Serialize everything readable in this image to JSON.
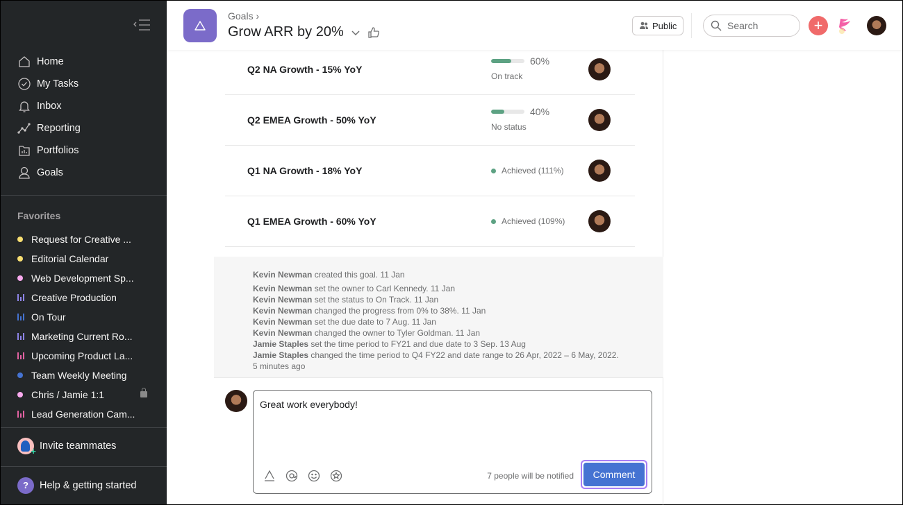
{
  "sidebar": {
    "nav": [
      {
        "label": "Home",
        "icon": "home-icon"
      },
      {
        "label": "My Tasks",
        "icon": "check-circle-icon"
      },
      {
        "label": "Inbox",
        "icon": "bell-icon"
      },
      {
        "label": "Reporting",
        "icon": "line-chart-icon"
      },
      {
        "label": "Portfolios",
        "icon": "portfolio-icon"
      },
      {
        "label": "Goals",
        "icon": "goals-icon"
      }
    ],
    "favorites_title": "Favorites",
    "favorites": [
      {
        "label": "Request for Creative ...",
        "type": "dot",
        "color": "#f8df72"
      },
      {
        "label": "Editorial Calendar",
        "type": "dot",
        "color": "#f8df72"
      },
      {
        "label": "Web Development Sp...",
        "type": "dot",
        "color": "#f9aaef"
      },
      {
        "label": "Creative Production",
        "type": "bars",
        "color": "#8d84e8"
      },
      {
        "label": "On Tour",
        "type": "bars",
        "color": "#4573d2"
      },
      {
        "label": "Marketing Current Ro...",
        "type": "bars",
        "color": "#8d84e8"
      },
      {
        "label": "Upcoming Product La...",
        "type": "bars",
        "color": "#e362a3"
      },
      {
        "label": "Team Weekly Meeting",
        "type": "dot",
        "color": "#4573d2"
      },
      {
        "label": "Chris / Jamie 1:1",
        "type": "dot",
        "color": "#f9aaef",
        "locked": true
      },
      {
        "label": "Lead Generation Cam...",
        "type": "bars",
        "color": "#e362a3"
      }
    ],
    "invite_label": "Invite teammates",
    "help_label": "Help & getting started"
  },
  "header": {
    "breadcrumb": "Goals",
    "title": "Grow ARR by 20%",
    "public_label": "Public",
    "search_placeholder": "Search"
  },
  "goals": [
    {
      "name": "Q2 NA Growth - 15% YoY",
      "progress": 60,
      "progress_label": "60%",
      "status": "On track"
    },
    {
      "name": "Q2 EMEA Growth - 50% YoY",
      "progress": 40,
      "progress_label": "40%",
      "status": "No status"
    },
    {
      "name": "Q1 NA Growth - 18% YoY",
      "achieved": "Achieved (111%)"
    },
    {
      "name": "Q1 EMEA Growth - 60% YoY",
      "achieved": "Achieved (109%)"
    }
  ],
  "activity": [
    {
      "actor": "Kevin Newman",
      "text": " created this goal.  11 Jan"
    },
    {
      "actor": "Kevin Newman",
      "text": " set the owner to Carl Kennedy.  11 Jan"
    },
    {
      "actor": "Kevin Newman",
      "text": " set the status to On Track.  11 Jan"
    },
    {
      "actor": "Kevin Newman",
      "text": " changed the progress from 0% to 38%.  11 Jan"
    },
    {
      "actor": "Kevin Newman",
      "text": " set the due date to 7 Aug.  11 Jan"
    },
    {
      "actor": "Kevin Newman",
      "text": " changed the owner to Tyler Goldman.  11 Jan"
    },
    {
      "actor": "Jamie Staples",
      "text": " set the time period to FY21 and due date to 3 Sep.  13 Aug"
    },
    {
      "actor": "Jamie Staples",
      "text": " changed the time period to Q4 FY22 and date range to 26 Apr, 2022 – 6 May, 2022.  5 minutes ago"
    }
  ],
  "composer": {
    "text": "Great work everybody!",
    "notify": "7 people will be notified",
    "comment_label": "Comment"
  },
  "colors": {
    "accent": "#4573d2",
    "progress": "#5da283",
    "goal_icon": "#7b6bc9",
    "add": "#f06a6a"
  }
}
